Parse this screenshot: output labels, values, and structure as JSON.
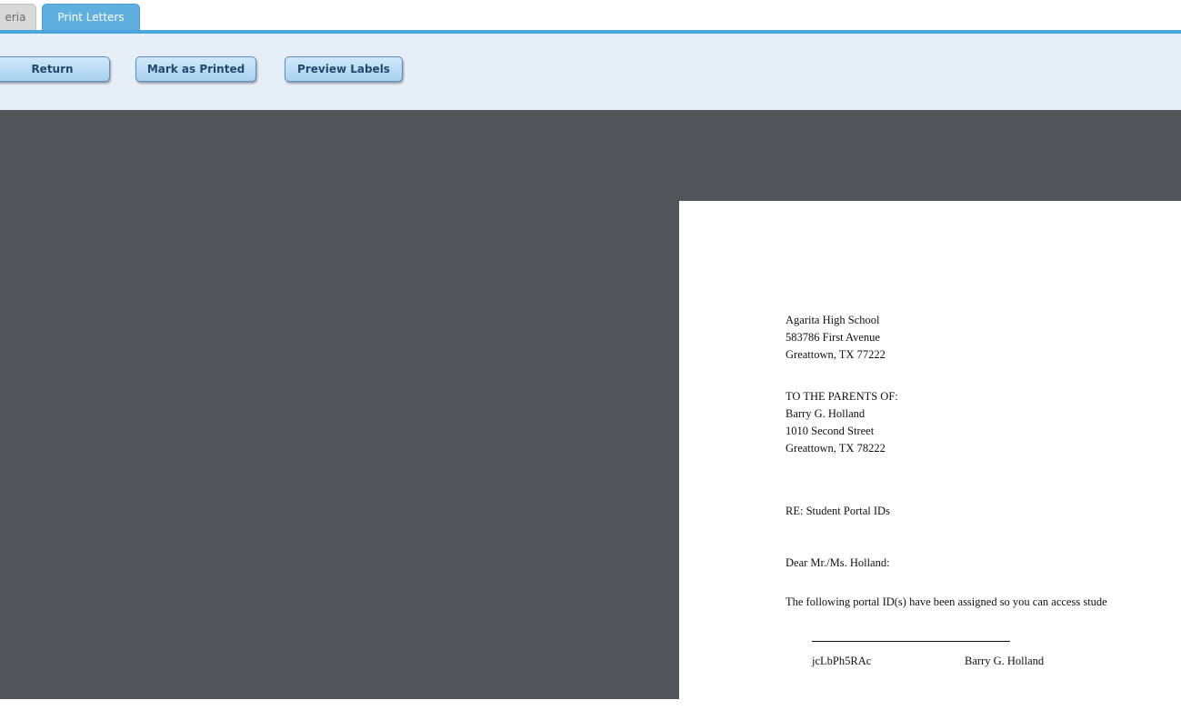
{
  "tabs": [
    {
      "label": "eria",
      "active": false
    },
    {
      "label": "Print Letters",
      "active": true
    }
  ],
  "toolbar": {
    "return_label": "Return",
    "mark_printed_label": "Mark as Printed",
    "preview_labels_label": "Preview Labels"
  },
  "letter": {
    "school_name": "Agarita High School",
    "school_address": "583786 First Avenue",
    "school_city": "Greattown, TX 77222",
    "to_line": "TO THE PARENTS OF:",
    "student_name": "Barry G. Holland",
    "student_address": "1010 Second Street",
    "student_city": "Greattown, TX 78222",
    "re_line": "RE: Student Portal IDs",
    "salutation": "Dear Mr./Ms. Holland:",
    "body": "The following portal ID(s) have been assigned so you can access stude",
    "portal_id": "jcLbPh5RAc",
    "portal_student": "Barry G. Holland"
  },
  "colors": {
    "tab_active": "#5fb0de",
    "tab_line": "#4aa6dc",
    "toolbar_bg": "#e6eef8",
    "viewer_bg": "#535659"
  }
}
